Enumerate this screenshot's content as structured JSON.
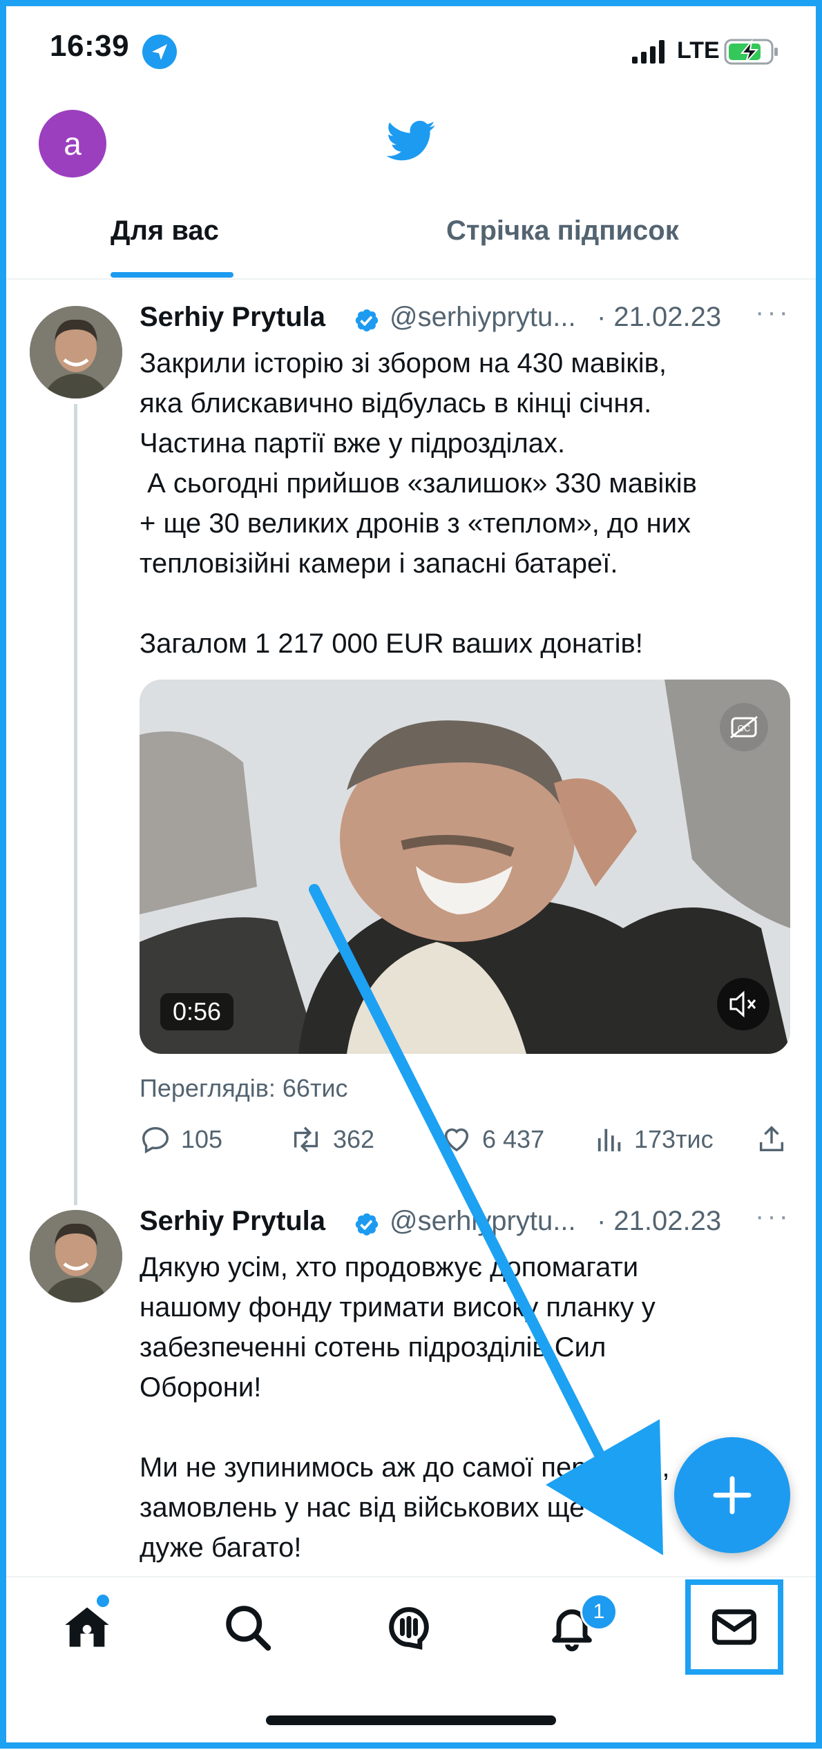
{
  "status_bar": {
    "time": "16:39",
    "network": "LTE"
  },
  "header": {
    "avatar_letter": "a"
  },
  "tabs": [
    {
      "label": "Для вас",
      "selected": true
    },
    {
      "label": "Стрічка підписок",
      "selected": false
    }
  ],
  "tweets": [
    {
      "author": "Serhiy Prytula",
      "handle": "@serhiyprytu...",
      "date": "· 21.02.23",
      "text": "Закрили історію зі збором на 430 мавіків,\nяка блискавично відбулась в кінці січня.\nЧастина партії вже у підрозділах.\n А сьогодні прийшов «залишок» 330 мавіків\n+ ще 30 великих дронів з «теплом», до них\nтепловізійні камери і запасні батареї.\n\nЗагалом 1 217 000 EUR ваших донатів!",
      "video_duration": "0:56",
      "views": "Переглядів: 66тис",
      "replies": "105",
      "retweets": "362",
      "likes": "6 437",
      "impressions": "173тис"
    },
    {
      "author": "Serhiy Prytula",
      "handle": "@serhiyprytu...",
      "date": "· 21.02.23",
      "text": "Дякую усім, хто продовжує допомагати\nнашому фонду тримати високу планку у\nзабезпеченні сотень підрозділів Сил\nОборони!\n\nМи не зупинимось аж до самої перемоги,\nзамовлень у нас від військових ще\nдуже багато!"
    }
  ],
  "nav": {
    "notifications_badge": "1"
  },
  "colors": {
    "accent": "#1d9bf0",
    "annotation": "#1da1f2",
    "avatar": "#9b3fbf"
  }
}
